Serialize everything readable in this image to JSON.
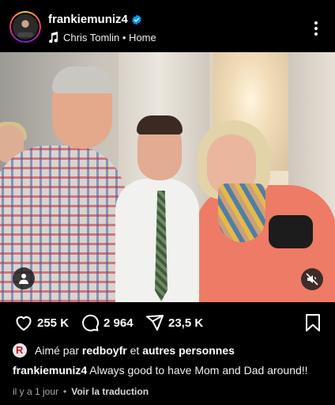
{
  "header": {
    "username": "frankiemuniz4",
    "music": "Chris Tomlin • Home"
  },
  "post": {
    "photo_alt": "",
    "actions": {
      "likes": "255 K",
      "comments": "2 964",
      "shares": "23,5 K"
    },
    "liked_by": {
      "prefix": "Aimé par",
      "user": "redboyfr",
      "connector": "et",
      "others": "autres personnes"
    },
    "caption": {
      "username": "frankiemuniz4",
      "text": "Always good to have Mom and Dad around!!"
    },
    "meta": {
      "time": "il y a 1 jour",
      "separator": "•",
      "translate": "Voir la traduction"
    }
  },
  "colors": {
    "background": "#000000",
    "verified": "#0095f6",
    "text": "#ffffff",
    "muted": "#a8a8a8"
  }
}
